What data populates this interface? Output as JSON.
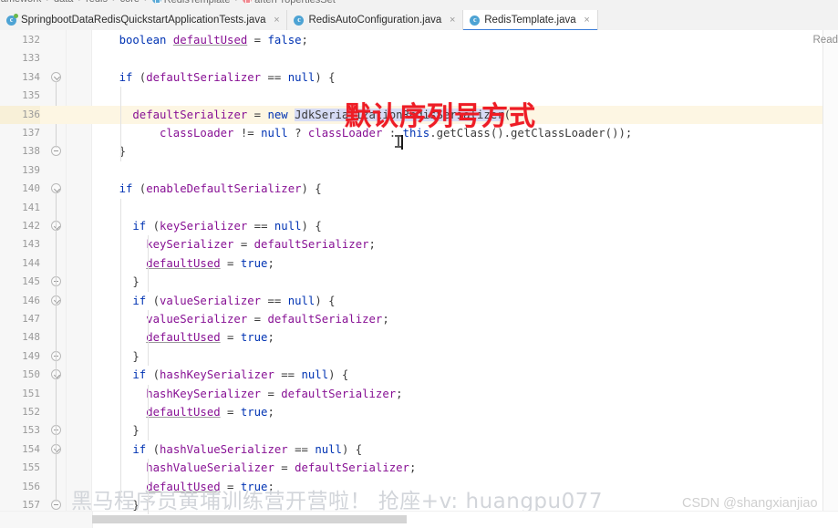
{
  "window": {
    "app": "IntelliJ IDEA Editor",
    "read_hint": "Read"
  },
  "breadcrumb": {
    "items": [
      {
        "label": "framework",
        "icon": "none"
      },
      {
        "label": "data",
        "icon": "none"
      },
      {
        "label": "redis",
        "icon": "none"
      },
      {
        "label": "core",
        "icon": "none"
      },
      {
        "label": "RedisTemplate",
        "icon": "class-icon"
      },
      {
        "label": "afterPropertiesSet",
        "icon": "method-icon"
      }
    ],
    "separator": "›"
  },
  "tabs": [
    {
      "label": "SpringbootDataRedisQuickstartApplicationTests.java",
      "icon": "java-class-test-icon",
      "active": false,
      "close": "×"
    },
    {
      "label": "RedisAutoConfiguration.java",
      "icon": "java-class-icon",
      "active": false,
      "close": "×"
    },
    {
      "label": "RedisTemplate.java",
      "icon": "java-class-icon",
      "active": true,
      "close": "×"
    }
  ],
  "annotation": {
    "text": "默认序列号方式",
    "color": "#ee1c25"
  },
  "watermarks": {
    "promo": "黑马程序员黄埔训练营开营啦！ 抢座+v: huangpu077",
    "csdn": "CSDN @shangxianjiao"
  },
  "editor": {
    "selection_text": "JdkSerializationRedisSerializer",
    "highlighted_line": 136,
    "first_line": 132,
    "last_line": 157,
    "lines": [
      {
        "n": "132",
        "indent": 2,
        "fold": "",
        "code": "boolean defaultUsed = false;"
      },
      {
        "n": "133",
        "indent": 0,
        "fold": "",
        "code": ""
      },
      {
        "n": "134",
        "indent": 2,
        "fold": "down",
        "code": "if (defaultSerializer == null) {"
      },
      {
        "n": "135",
        "indent": 0,
        "fold": "",
        "code": ""
      },
      {
        "n": "136",
        "indent": 3,
        "fold": "",
        "code": "defaultSerializer = new JdkSerializationRedisSerializer("
      },
      {
        "n": "137",
        "indent": 5,
        "fold": "",
        "code": "classLoader != null ? classLoader : this.getClass().getClassLoader());"
      },
      {
        "n": "138",
        "indent": 2,
        "fold": "end",
        "code": "}"
      },
      {
        "n": "139",
        "indent": 0,
        "fold": "",
        "code": ""
      },
      {
        "n": "140",
        "indent": 2,
        "fold": "down",
        "code": "if (enableDefaultSerializer) {"
      },
      {
        "n": "141",
        "indent": 0,
        "fold": "",
        "code": ""
      },
      {
        "n": "142",
        "indent": 3,
        "fold": "down",
        "code": "if (keySerializer == null) {"
      },
      {
        "n": "143",
        "indent": 4,
        "fold": "",
        "code": "keySerializer = defaultSerializer;"
      },
      {
        "n": "144",
        "indent": 4,
        "fold": "",
        "code": "defaultUsed = true;"
      },
      {
        "n": "145",
        "indent": 3,
        "fold": "end",
        "code": "}"
      },
      {
        "n": "146",
        "indent": 3,
        "fold": "down",
        "code": "if (valueSerializer == null) {"
      },
      {
        "n": "147",
        "indent": 4,
        "fold": "",
        "code": "valueSerializer = defaultSerializer;"
      },
      {
        "n": "148",
        "indent": 4,
        "fold": "",
        "code": "defaultUsed = true;"
      },
      {
        "n": "149",
        "indent": 3,
        "fold": "end",
        "code": "}"
      },
      {
        "n": "150",
        "indent": 3,
        "fold": "down",
        "code": "if (hashKeySerializer == null) {"
      },
      {
        "n": "151",
        "indent": 4,
        "fold": "",
        "code": "hashKeySerializer = defaultSerializer;"
      },
      {
        "n": "152",
        "indent": 4,
        "fold": "",
        "code": "defaultUsed = true;"
      },
      {
        "n": "153",
        "indent": 3,
        "fold": "end",
        "code": "}"
      },
      {
        "n": "154",
        "indent": 3,
        "fold": "down",
        "code": "if (hashValueSerializer == null) {"
      },
      {
        "n": "155",
        "indent": 4,
        "fold": "",
        "code": "hashValueSerializer = defaultSerializer;"
      },
      {
        "n": "156",
        "indent": 4,
        "fold": "",
        "code": "defaultUsed = true;"
      },
      {
        "n": "157",
        "indent": 3,
        "fold": "end",
        "code": "}"
      }
    ]
  },
  "scrollbar": {
    "orientation": "horizontal",
    "thumb_label": "h-scroll-thumb"
  }
}
